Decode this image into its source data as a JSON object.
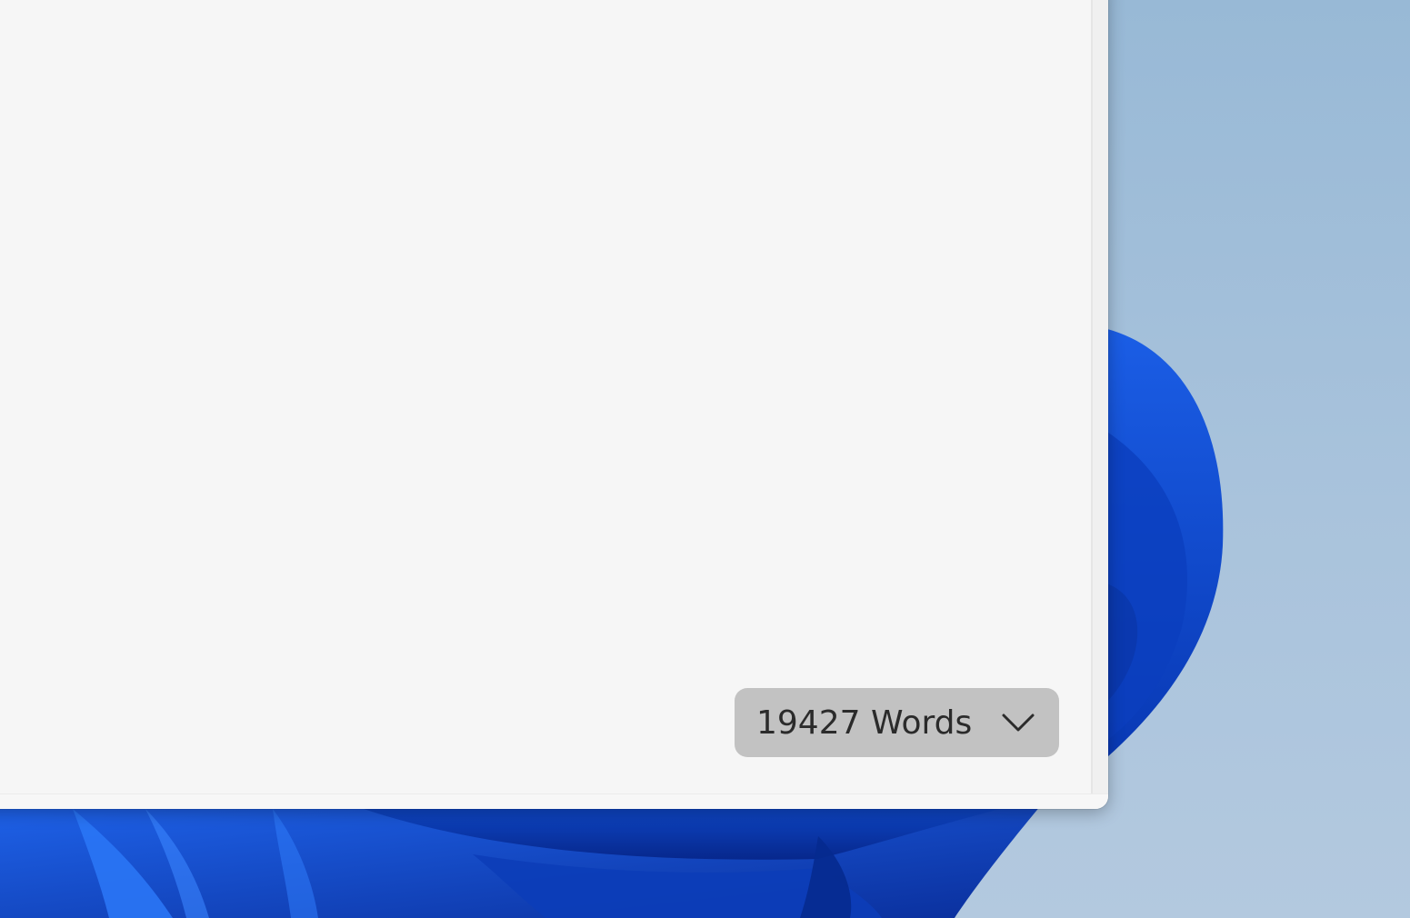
{
  "status_bar": {
    "word_count_label": "19427 Words"
  },
  "icons": {
    "dropdown": "chevron-down-icon"
  },
  "colors": {
    "window_bg": "#f6f6f6",
    "pill_bg": "#c2c2c2",
    "text": "#2b2b2b",
    "wallpaper_blue": "#0a4fd0",
    "sky": "#a5c0da"
  }
}
